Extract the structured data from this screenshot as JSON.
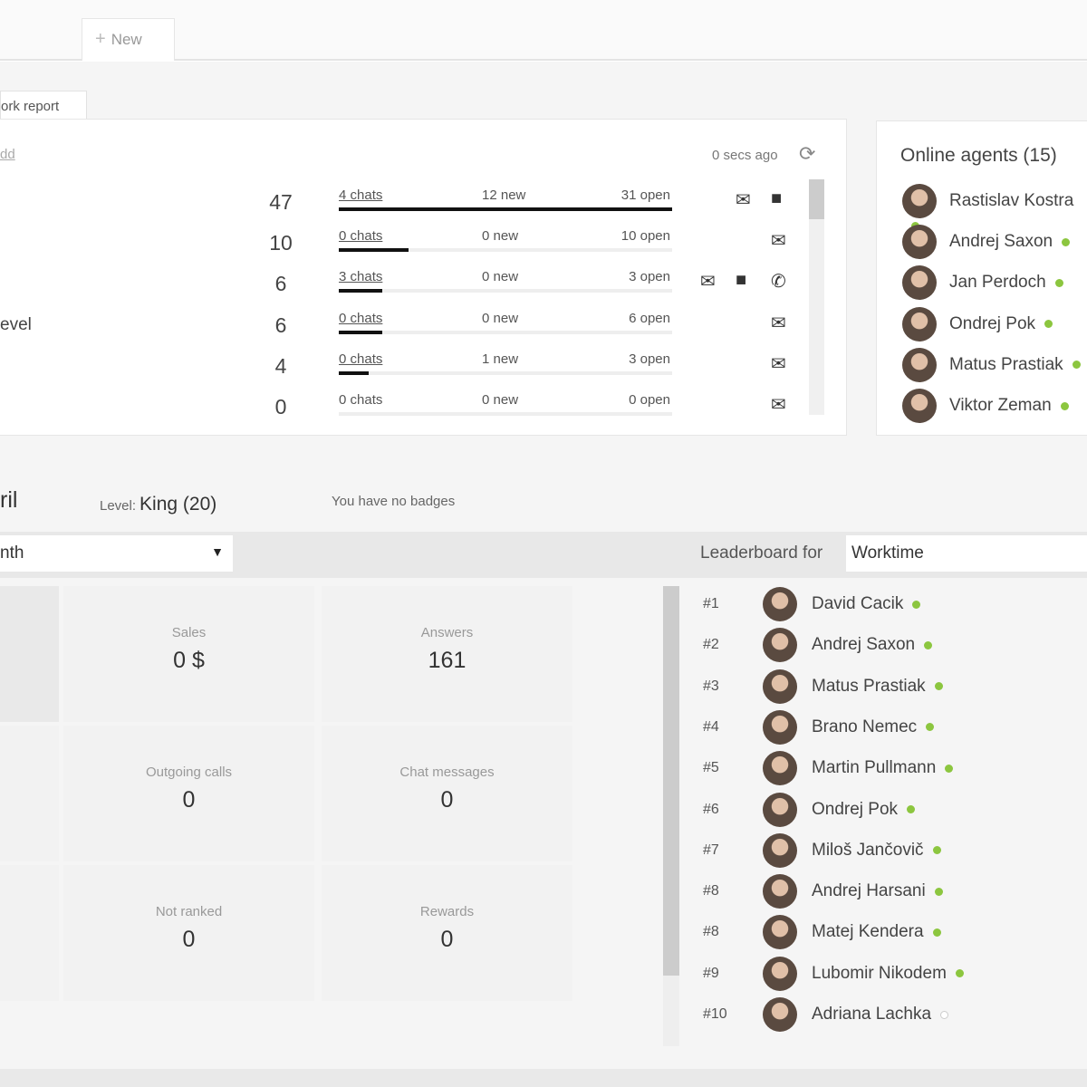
{
  "tabs": {
    "new_label": "New",
    "work_report": "ork report"
  },
  "queue": {
    "add_link": "dd",
    "updated": "0 secs ago",
    "rows": [
      {
        "label": "",
        "count": "47",
        "chats": "4 chats",
        "new": "12 new",
        "open": "31 open",
        "fill": 1.0,
        "icons": [
          "mail",
          "chat"
        ]
      },
      {
        "label": "",
        "count": "10",
        "chats": "0 chats",
        "new": "0 new",
        "open": "10 open",
        "fill": 0.21,
        "icons": [
          "mail"
        ]
      },
      {
        "label": "",
        "count": "6",
        "chats": "3 chats",
        "new": "0 new",
        "open": "3 open",
        "fill": 0.13,
        "icons": [
          "mail",
          "chat",
          "phone"
        ]
      },
      {
        "label": "evel",
        "count": "6",
        "chats": "0 chats",
        "new": "0 new",
        "open": "6 open",
        "fill": 0.13,
        "icons": [
          "mail"
        ]
      },
      {
        "label": "",
        "count": "4",
        "chats": "0 chats",
        "new": "1 new",
        "open": "3 open",
        "fill": 0.09,
        "icons": [
          "mail"
        ]
      },
      {
        "label": "",
        "count": "0",
        "chats": "0 chats",
        "new": "0 new",
        "open": "0 open",
        "fill": 0,
        "icons": [
          "mail"
        ]
      }
    ]
  },
  "online_agents": {
    "title": "Online agents (15)",
    "agents": [
      "Rastislav Kostra",
      "Andrej Saxon",
      "Jan Perdoch",
      "Ondrej Pok",
      "Matus Prastiak",
      "Viktor Zeman"
    ]
  },
  "gamification": {
    "name": "ril",
    "level_label": "Level:",
    "level_value": "King (20)",
    "badges": "You have no badges",
    "period": "nth",
    "leaderboard_label": "Leaderboard for",
    "leaderboard_value": "Worktime"
  },
  "stats": [
    {
      "label": "Sales",
      "value": "0 $"
    },
    {
      "label": "Answers",
      "value": "161"
    },
    {
      "label": "Outgoing calls",
      "value": "0"
    },
    {
      "label": "Chat messages",
      "value": "0"
    },
    {
      "label": "Not ranked",
      "value": "0"
    },
    {
      "label": "Rewards",
      "value": "0"
    }
  ],
  "leaderboard": [
    {
      "rank": "#1",
      "name": "David Cacik",
      "online": true
    },
    {
      "rank": "#2",
      "name": "Andrej Saxon",
      "online": true
    },
    {
      "rank": "#3",
      "name": "Matus Prastiak",
      "online": true
    },
    {
      "rank": "#4",
      "name": "Brano Nemec",
      "online": true
    },
    {
      "rank": "#5",
      "name": "Martin Pullmann",
      "online": true
    },
    {
      "rank": "#6",
      "name": "Ondrej Pok",
      "online": true
    },
    {
      "rank": "#7",
      "name": "Miloš Jančovič",
      "online": true
    },
    {
      "rank": "#8",
      "name": "Andrej Harsani",
      "online": true
    },
    {
      "rank": "#8",
      "name": "Matej Kendera",
      "online": true
    },
    {
      "rank": "#9",
      "name": "Lubomir Nikodem",
      "online": true
    },
    {
      "rank": "#10",
      "name": "Adriana Lachka",
      "online": false
    }
  ]
}
